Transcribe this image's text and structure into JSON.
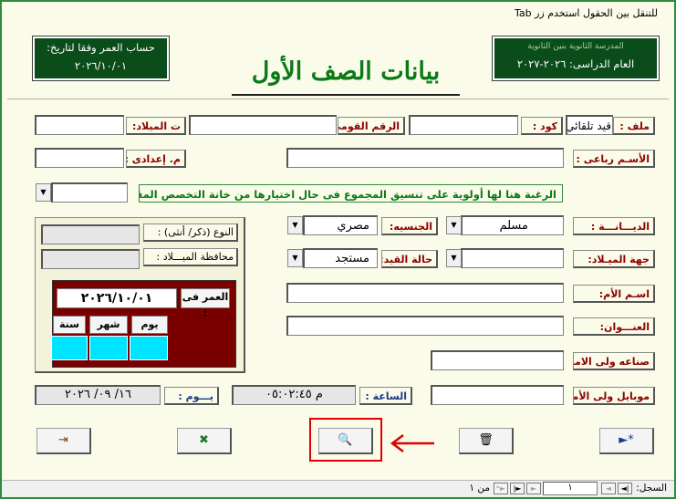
{
  "window": {
    "title": "للتنقل بين الحقول استخدم زر Tab"
  },
  "header": {
    "left_box": {
      "line1": "حساب العمر   وفقا لتاريخ:",
      "line2": "٢٠٢٦/١٠/٠١"
    },
    "right_box": {
      "line1": "المدرسة الثانوية بنين الثانوية",
      "line2": "العام الدراسى: ٢٠٢٦-٢٠٢٧"
    },
    "main_title": "بيانات الصف الأول"
  },
  "fields": {
    "file_label": "ملف :",
    "file_value": "قيد تلقائي",
    "code_label": "كود :",
    "code_value": "",
    "national_id_label": "الرقم القومى:",
    "national_id_value": "",
    "birth_date_label": "ت الميلاد:",
    "birth_date_value": "",
    "full_name_label": "الأسـم رباعى :",
    "full_name_value": "",
    "prep_label": "م. إعدادى :",
    "prep_value": "",
    "note": "الرغبة هنا لها أولوية على تنسيق المجموع فى حال اختيارها من خانة التخصص المقابلة  ⟸",
    "preference_value": "",
    "religion_label": "الديـــانـــة :",
    "religion_value": "مسلم",
    "nationality_label": "الجنسيه:",
    "nationality_value": "مصري",
    "birth_place_label": "جهة الميـلاد:",
    "birth_place_value": "",
    "status_label": "حالة القيد:",
    "status_value": "مستجد",
    "mother_label": "اسـم الأم:",
    "mother_value": "",
    "address_label": "العنـــوان:",
    "address_value": "",
    "guardian_job_label": "صناعه ولى الامر:",
    "guardian_job_value": "",
    "guardian_mobile_label": "موبايل ولى الأمر:",
    "guardian_mobile_value": ""
  },
  "panel": {
    "gender_label": "النوع (ذكر/ أنثى) :",
    "birth_governorate_label": "محافظة الميـــلاد :",
    "age_at_label": "العمر فى :",
    "age_at_value": "٢٠٢٦/١٠/٠١",
    "day_label": "يوم",
    "month_label": "شهر",
    "year_label": "سنة"
  },
  "footer": {
    "time_label": "الساعة :",
    "time_value": "م  ٠٥:٠٢:٤٥",
    "day_label": "يـــوم :",
    "day_value": "١٦/ ٠٩/ ٢٠٢٦"
  },
  "buttons": {
    "new_record_icon": "►*",
    "delete_icon": "🗑",
    "search_icon": "🔍",
    "excel_icon": "✖",
    "exit_icon": "⇥"
  },
  "navbar": {
    "record_label": "السجل:",
    "current": "١",
    "of_label": "من ١",
    "first_icon": "|◄",
    "prev_icon": "◄",
    "next_icon": "►",
    "last_icon": "►|",
    "new_icon": "►*"
  },
  "colors": {
    "accent_green": "#0b4d1a",
    "title_green": "#0a7a18",
    "label_red": "#8b0000",
    "maroon": "#7a0000",
    "cyan": "#00e5ff",
    "highlight_red": "#e00000"
  }
}
